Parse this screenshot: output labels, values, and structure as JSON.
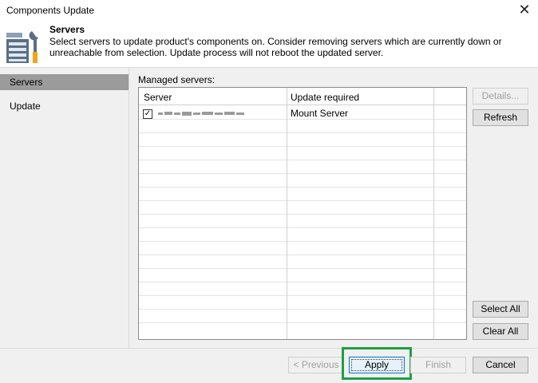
{
  "window": {
    "title": "Components Update"
  },
  "header": {
    "title": "Servers",
    "description": "Select servers to update product's components on. Consider removing servers which are currently down or unreachable from selection. Update process will not reboot the updated server."
  },
  "sidebar": {
    "items": [
      {
        "label": "Servers",
        "active": true
      },
      {
        "label": "Update",
        "active": false
      }
    ]
  },
  "content": {
    "managed_label": "Managed servers:",
    "columns": [
      "Server",
      "Update required"
    ],
    "rows": [
      {
        "checked": true,
        "update_required": "Mount Server"
      }
    ]
  },
  "side_buttons": {
    "details": "Details...",
    "refresh": "Refresh",
    "select_all": "Select All",
    "clear_all": "Clear All"
  },
  "footer_buttons": {
    "previous": "< Previous",
    "apply": "Apply",
    "finish": "Finish",
    "cancel": "Cancel"
  },
  "colors": {
    "highlight": "#1ea043",
    "sidebar_active": "#9b9b9b",
    "panel_bg": "#f0f0f0"
  },
  "icons": {
    "close": "close-icon",
    "header": "server-tools-icon",
    "check": "checkmark-icon"
  }
}
